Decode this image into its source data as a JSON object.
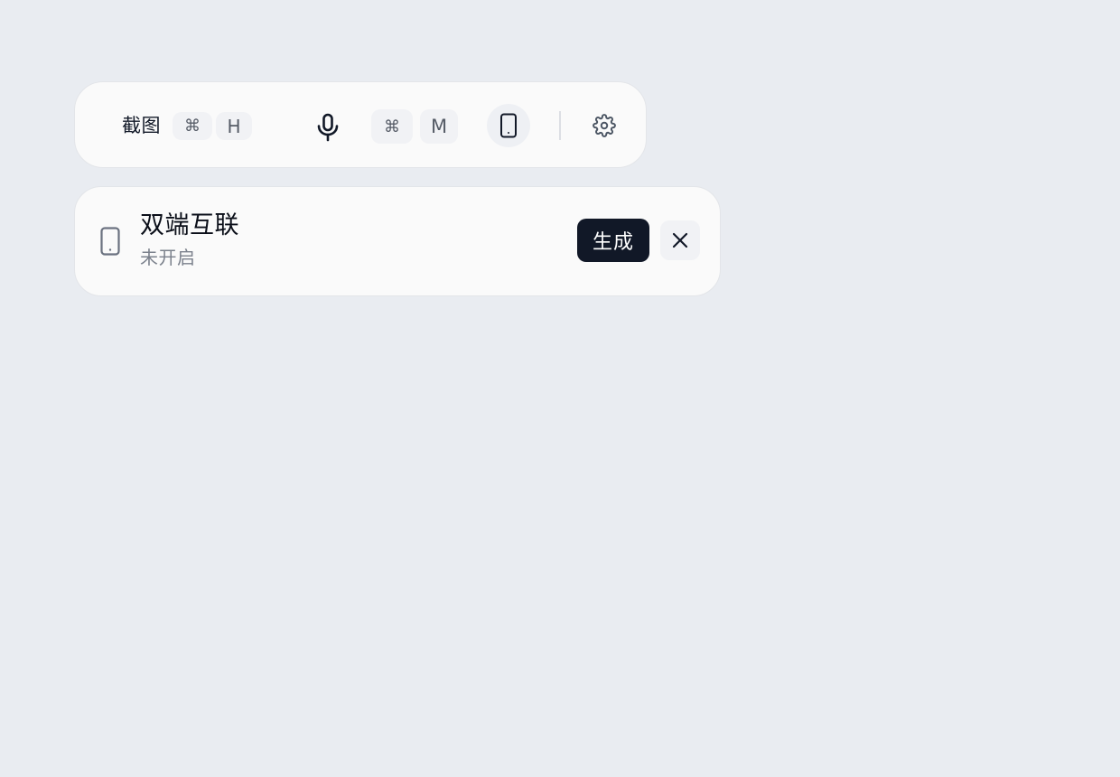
{
  "toolbar": {
    "screenshot_label": "截图",
    "screenshot_shortcut": {
      "modifier": "⌘",
      "key": "H"
    },
    "mic_icon": "microphone-icon",
    "mic_shortcut": {
      "modifier": "⌘",
      "key": "M"
    },
    "device_icon": "tablet-icon",
    "settings_icon": "gear-icon"
  },
  "panel": {
    "icon": "tablet-icon",
    "title": "双端互联",
    "status": "未开启",
    "generate_label": "生成",
    "close_icon": "close-icon"
  },
  "colors": {
    "background": "#e9ecf1",
    "card": "#fafafa",
    "primary_button": "#111827",
    "muted_text": "#7b818c"
  }
}
